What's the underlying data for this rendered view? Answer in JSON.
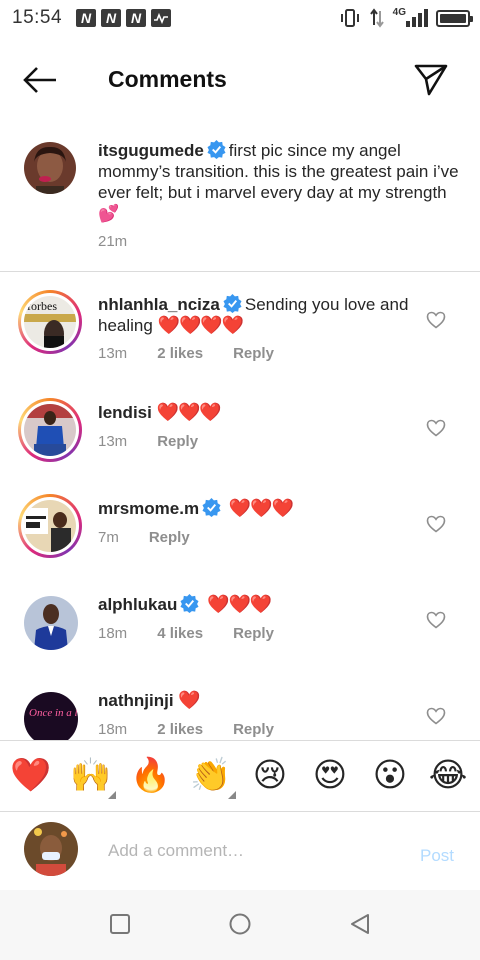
{
  "status_bar": {
    "time": "15:54",
    "notification_icons": [
      "N",
      "N",
      "N"
    ],
    "network": "4G",
    "battery_level": 1.0
  },
  "header": {
    "title": "Comments"
  },
  "caption": {
    "username": "itsgugumede",
    "verified": true,
    "text": "first pic since my angel mommy’s transition. this is the greatest pain i’ve ever felt; but i marvel every day at my strength",
    "emoji": "💕",
    "time": "21m"
  },
  "comments": [
    {
      "username": "nhlanhla_nciza",
      "verified": true,
      "text": "Sending you love and healing",
      "hearts": "❤️❤️❤️❤️",
      "time": "13m",
      "likes": "2 likes",
      "reply": "Reply"
    },
    {
      "username": "lendisi",
      "verified": false,
      "text": "",
      "hearts": "❤️❤️❤️",
      "time": "13m",
      "likes": "",
      "reply": "Reply"
    },
    {
      "username": "mrsmome.m",
      "verified": true,
      "text": "",
      "hearts": "❤️❤️❤️",
      "time": "7m",
      "likes": "",
      "reply": "Reply"
    },
    {
      "username": "alphlukau",
      "verified": true,
      "text": "",
      "hearts": "❤️❤️❤️",
      "time": "18m",
      "likes": "4 likes",
      "reply": "Reply"
    },
    {
      "username": "nathnjinji",
      "verified": false,
      "text": "",
      "hearts": "❤️",
      "time": "18m",
      "likes": "2 likes",
      "reply": "Reply"
    }
  ],
  "emoji_bar": [
    "❤️",
    "🙌",
    "🔥",
    "👏",
    "😢",
    "😍",
    "😮",
    "😂"
  ],
  "composer": {
    "placeholder": "Add a comment…",
    "post_label": "Post"
  },
  "avatar_texts": {
    "nhlanhla": "forbes",
    "nathnjinji": "Once in a lifetime"
  },
  "colors": {
    "verified_blue": "#3897f0",
    "heart_red": "#e0162b",
    "post_disabled": "#b3dbff"
  }
}
